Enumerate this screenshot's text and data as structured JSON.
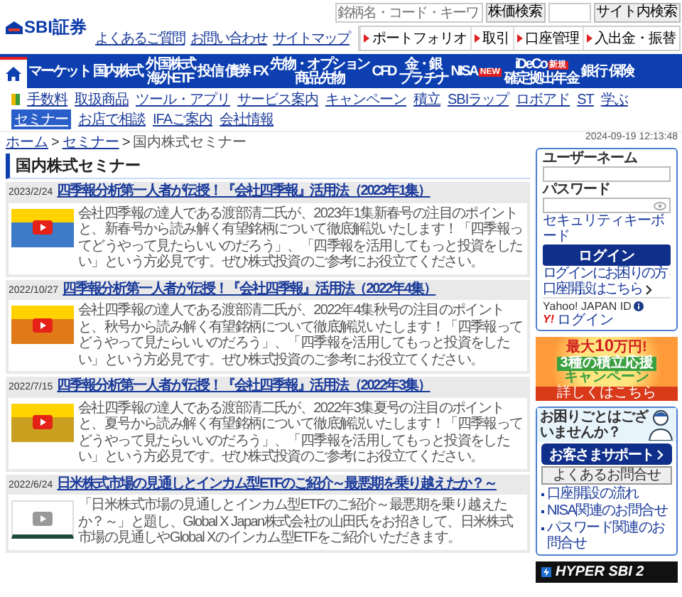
{
  "header": {
    "logo_text": "SBI証券",
    "stock_search": {
      "placeholder": "銘柄名・コード・キーワ"
    },
    "stock_search_button": "株価検索",
    "site_search_button": "サイト内検索",
    "links": [
      "よくあるご質問",
      "お問い合わせ",
      "サイトマップ"
    ],
    "quick_buttons": [
      "ポートフォリオ",
      "取引",
      "口座管理",
      "入出金・振替"
    ]
  },
  "main_nav": [
    {
      "kind": "home",
      "selected": true
    },
    {
      "kind": "text",
      "label": "マーケット",
      "selected": false
    },
    {
      "kind": "text",
      "label": "国内株式",
      "selected": false
    },
    {
      "kind": "text",
      "label": "外国株式",
      "sublabel": "海外ETF",
      "selected": false
    },
    {
      "kind": "text",
      "label": "投信",
      "selected": false
    },
    {
      "kind": "text",
      "label": "債券",
      "selected": false
    },
    {
      "kind": "text",
      "label": "FX",
      "selected": false
    },
    {
      "kind": "text",
      "label": "先物・オプション",
      "sublabel": "商品先物",
      "selected": false
    },
    {
      "kind": "text",
      "label": "CFD",
      "selected": false
    },
    {
      "kind": "text",
      "label": "金・銀",
      "sublabel": "プラチナ",
      "selected": false
    },
    {
      "kind": "text",
      "label": "NISA",
      "badge": "NEW",
      "selected": false
    },
    {
      "kind": "text",
      "label": "iDeCo",
      "badge": "新規",
      "sublabel": "確定拠出年金",
      "selected": false
    },
    {
      "kind": "text",
      "label": "銀行",
      "selected": false
    },
    {
      "kind": "text",
      "label": "保険",
      "selected": false
    }
  ],
  "sub_nav": [
    {
      "label": "手数料",
      "selected": false
    },
    {
      "label": "取扱商品",
      "selected": false
    },
    {
      "label": "ツール・アプリ",
      "selected": false
    },
    {
      "label": "サービス案内",
      "selected": false
    },
    {
      "label": "キャンペーン",
      "selected": false
    },
    {
      "label": "積立",
      "selected": false
    },
    {
      "label": "SBIラップ",
      "selected": false
    },
    {
      "label": "ロボアド",
      "selected": false
    },
    {
      "label": "ST",
      "selected": false
    },
    {
      "label": "学ぶ",
      "selected": false
    },
    {
      "label": "セミナー",
      "selected": true
    },
    {
      "label": "お店で相談",
      "selected": false
    },
    {
      "label": "IFAご案内",
      "selected": false
    },
    {
      "label": "会社情報",
      "selected": false
    }
  ],
  "timestamp": "2024-09-19 12:13:48",
  "breadcrumb": {
    "separator": ">",
    "items": [
      {
        "label": "ホーム",
        "link": true
      },
      {
        "label": "セミナー",
        "link": true
      },
      {
        "label": "国内株式セミナー",
        "link": false
      }
    ]
  },
  "heading": "国内株式セミナー",
  "seminars": [
    {
      "date": "2023/2/24",
      "title": "四季報分析第一人者が伝授！『会社四季報』活用法（2023年1集）",
      "description": "会社四季報の達人である渡部清二氏が、2023年1集新春号の注目のポイントと、新春号から読み解く有望銘柄について徹底解説いたします！「四季報ってどうやって見たらいいのだろう」、「四季報を活用してもっと投資をしたい」という方必見です。ぜひ株式投資のご参考にお役立てください。"
    },
    {
      "date": "2022/10/27",
      "title": "四季報分析第一人者が伝授！『会社四季報』活用法（2022年4集）",
      "description": "会社四季報の達人である渡部清二氏が、2022年4集秋号の注目のポイントと、秋号から読み解く有望銘柄について徹底解説いたします！「四季報ってどうやって見たらいいのだろう」、「四季報を活用してもっと投資をしたい」という方必見です。ぜひ株式投資のご参考にお役立てください。"
    },
    {
      "date": "2022/7/15",
      "title": "四季報分析第一人者が伝授！『会社四季報』活用法（2022年3集）",
      "description": "会社四季報の達人である渡部清二氏が、2022年3集夏号の注目のポイントと、夏号から読み解く有望銘柄について徹底解説いたします！「四季報ってどうやって見たらいいのだろう」、「四季報を活用してもっと投資をしたい」という方必見です。ぜひ株式投資のご参考にお役立てください。"
    },
    {
      "date": "2022/6/24",
      "title": "日米株式市場の見通しとインカム型ETFのご紹介～最悪期を乗り越えたか？～",
      "description": "「日米株式市場の見通しとインカム型ETFのご紹介～最悪期を乗り越えたか？～」と題し、Global X Japan株式会社の山田氏をお招きして、日米株式市場の見通しやGlobal Xのインカム型ETFをご紹介いただきます。"
    }
  ],
  "sidebar": {
    "login": {
      "username_label": "ユーザーネーム",
      "password_label": "パスワード",
      "security_keyboard": "セキュリティキーボード",
      "login_button": "ログイン",
      "help_links": [
        "ログインにお困りの方",
        "口座開設はこちら"
      ],
      "yahoo_label": "Yahoo! JAPAN ID",
      "yahoo_logo": "Y!",
      "yahoo_login": "ログイン"
    },
    "banner": {
      "prefix": "最大",
      "amount": "10",
      "suffix": "万円!",
      "title": "3種の積立応援",
      "subtitle": "キャンペーン",
      "link": "詳しくはこちら"
    },
    "support": {
      "question": "お困りごとはございませんか？",
      "button": "お客さまサポート",
      "faq_label": "よくあるお問合せ",
      "links": [
        "口座開設の流れ",
        "NISA関連のお問合せ",
        "パスワード関連のお問合せ"
      ]
    },
    "app_banner": "HYPER SBI 2"
  }
}
